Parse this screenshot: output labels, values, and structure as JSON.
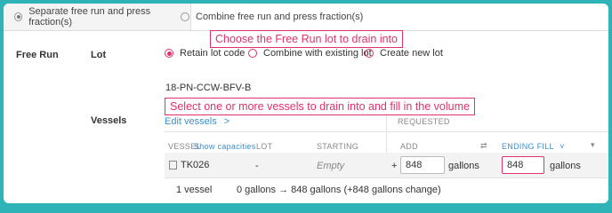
{
  "mode_tabs": [
    {
      "label": "Separate free run and press fraction(s)",
      "selected": true
    },
    {
      "label": "Combine free run and press fraction(s)",
      "selected": false
    }
  ],
  "annotations": {
    "lot_hint": "Choose the Free Run lot to drain into",
    "vessel_hint": "Select one or more vessels to drain into and fill in the volume"
  },
  "section": {
    "title": "Free Run",
    "lot_label": "Lot",
    "lot_options": [
      {
        "label": "Retain lot code",
        "selected": true
      },
      {
        "label": "Combine with existing lot",
        "selected": false
      },
      {
        "label": "Create new lot",
        "selected": false
      }
    ],
    "lot_code": "18-PN-CCW-BFV-B",
    "vessels_label": "Vessels",
    "edit_vessels": "Edit vessels",
    "edit_vessels_chevron": ">",
    "requested_header": "REQUESTED"
  },
  "table": {
    "headers": {
      "vessel": "VESSEL",
      "show_capacities": "Show capacities",
      "lot": "LOT",
      "starting": "STARTING",
      "add": "ADD",
      "ending_fill": "ENDING FILL",
      "ending_chevron": "˅",
      "swap_icon": "⇄"
    },
    "row": {
      "vessel": "TK026",
      "lot": "-",
      "starting": "Empty",
      "plus": "+",
      "add_value": "848",
      "add_unit": "gallons",
      "ending_value": "848",
      "ending_unit": "gallons"
    },
    "footer": {
      "count": "1 vessel",
      "summary": "0 gallons → 848 gallons (+848 gallons change)"
    }
  },
  "colors": {
    "background": "#2fb3b6",
    "annotation": "#e0306d",
    "link": "#3a8fd0"
  }
}
